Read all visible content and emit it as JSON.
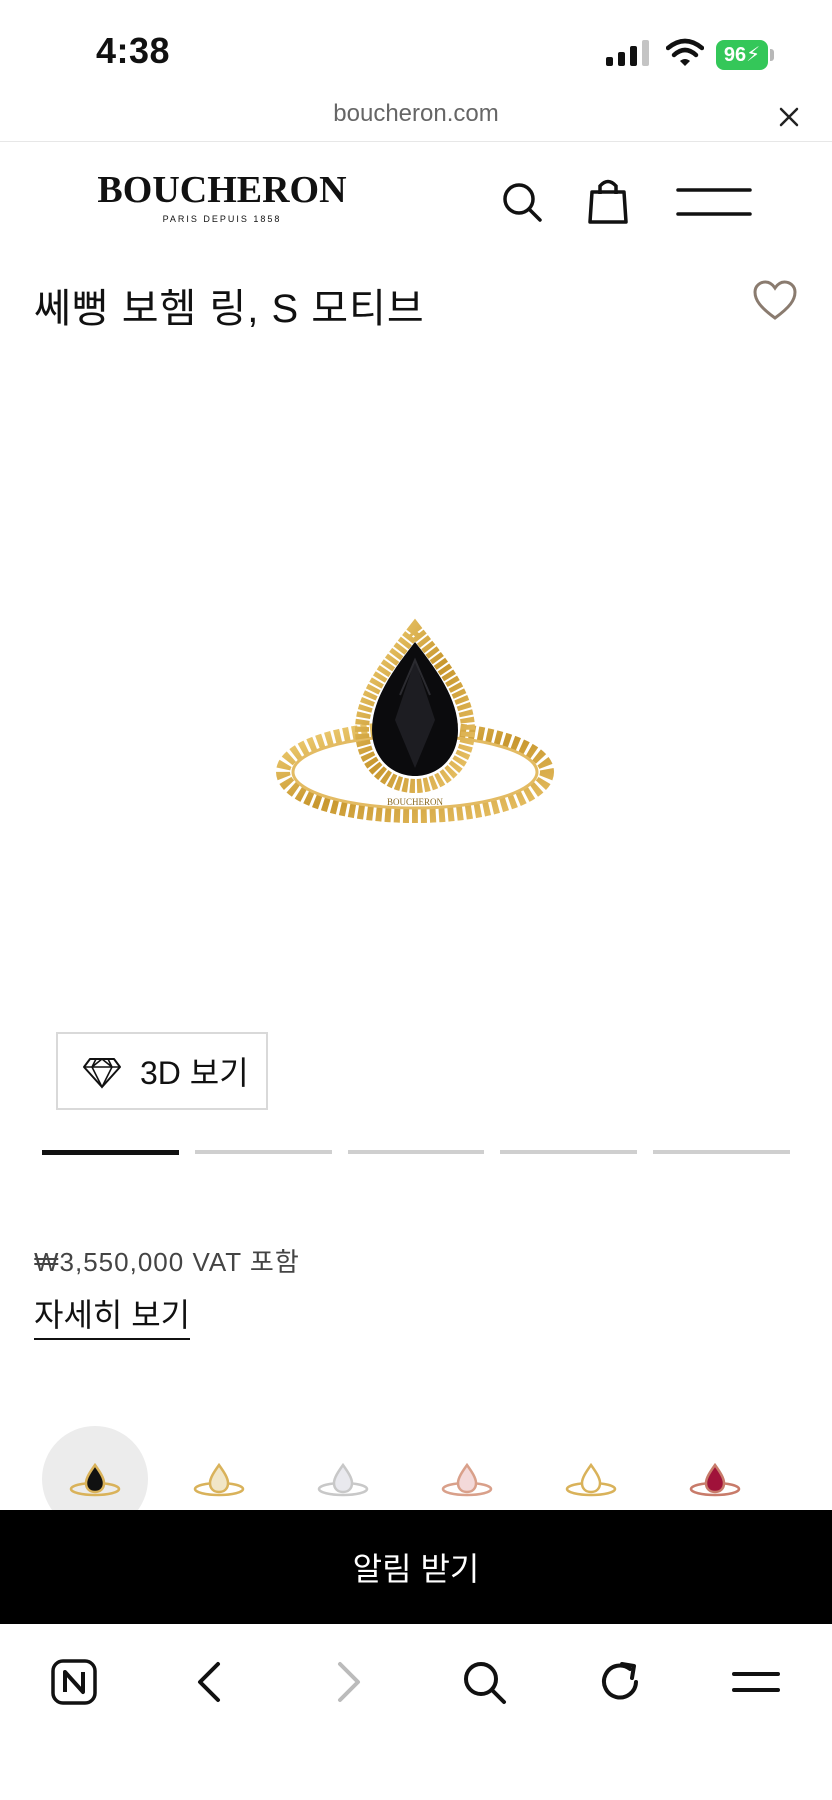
{
  "status_bar": {
    "time": "4:38",
    "battery_level": "96",
    "icons": [
      "signal-icon",
      "wifi-icon",
      "battery-charging-icon"
    ]
  },
  "browser": {
    "url": "boucheron.com",
    "icons": [
      "close-icon",
      "naver-home-icon",
      "back-icon",
      "forward-icon",
      "search-icon",
      "reload-icon",
      "menu-icon"
    ]
  },
  "site_header": {
    "brand": "BOUCHERON",
    "tagline": "PARIS DEPUIS 1858",
    "icons": [
      "search-icon",
      "shopping-bag-icon",
      "hamburger-menu-icon"
    ]
  },
  "product": {
    "title": "쎄뻥 보헴 링, S 모티브",
    "image_engraving": "BOUCHERON",
    "view_3d_label": "3D 보기",
    "gallery_count": 5,
    "gallery_active_index": 0,
    "price": "₩3,550,000",
    "price_suffix": "VAT 포함",
    "details_label": "자세히 보기",
    "variants": [
      {
        "stone": "#111111",
        "metal": "#d9b25a"
      },
      {
        "stone": "#f1e6c7",
        "metal": "#d9b25a"
      },
      {
        "stone": "#e9e9ee",
        "metal": "#c8c8c8"
      },
      {
        "stone": "#f3d9d9",
        "metal": "#d9a08a"
      },
      {
        "stone": "#ffffff",
        "metal": "#d9b25a"
      },
      {
        "stone": "#a0123a",
        "metal": "#c87b6a"
      }
    ]
  },
  "cta": {
    "label": "알림 받기"
  },
  "colors": {
    "accent_battery": "#34c759",
    "gold": "#d4a63b",
    "cta_background": "#000000"
  }
}
